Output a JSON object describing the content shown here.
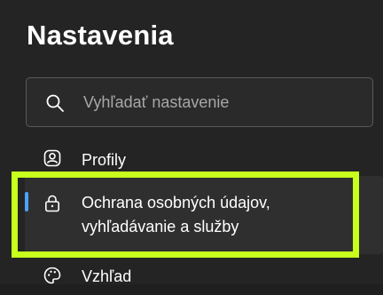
{
  "page": {
    "title": "Nastavenia"
  },
  "search": {
    "placeholder": "Vyhľadať nastavenie",
    "icon": "search-icon"
  },
  "sidebar": {
    "items": [
      {
        "label": "Profily",
        "icon": "profile-icon",
        "selected": false
      },
      {
        "label": "Ochrana osobných údajov,\nvyhľadávanie a služby",
        "icon": "lock-icon",
        "selected": true
      },
      {
        "label": "Vzhľad",
        "icon": "palette-icon",
        "selected": false
      }
    ]
  },
  "colors": {
    "background": "#242424",
    "selected_background": "#2f2f2f",
    "accent": "#4aa3ff",
    "highlight": "#c8ff1c",
    "text": "#ffffff",
    "placeholder": "#a8a8a8"
  }
}
